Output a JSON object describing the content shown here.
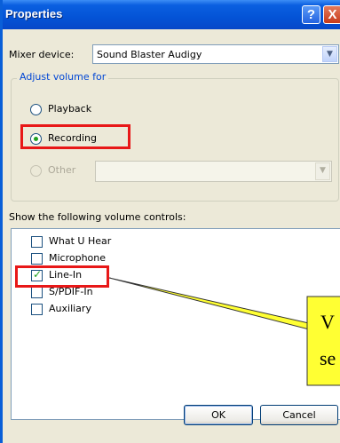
{
  "window": {
    "title": "Properties"
  },
  "titlebar": {
    "help_glyph": "?",
    "close_glyph": "X"
  },
  "mixer": {
    "label": "Mixer device:",
    "value": "Sound Blaster Audigy"
  },
  "adjust": {
    "group_title": "Adjust volume for",
    "options": [
      {
        "label": "Playback",
        "selected": false,
        "disabled": false
      },
      {
        "label": "Recording",
        "selected": true,
        "disabled": false
      },
      {
        "label": "Other",
        "selected": false,
        "disabled": true
      }
    ]
  },
  "controls": {
    "heading": "Show the following volume controls:",
    "items": [
      {
        "label": "What U Hear",
        "checked": false
      },
      {
        "label": "Microphone",
        "checked": false
      },
      {
        "label": "Line-In",
        "checked": true
      },
      {
        "label": "S/PDIF-In",
        "checked": false
      },
      {
        "label": "Auxiliary",
        "checked": false
      }
    ]
  },
  "buttons": {
    "ok": "OK",
    "cancel": "Cancel"
  },
  "callout": {
    "line1": "V",
    "line2": "se"
  },
  "colors": {
    "highlight": "#e81818",
    "callout_fill": "#ffff33",
    "check": "#21a121",
    "title_blue": "#0453d6"
  }
}
